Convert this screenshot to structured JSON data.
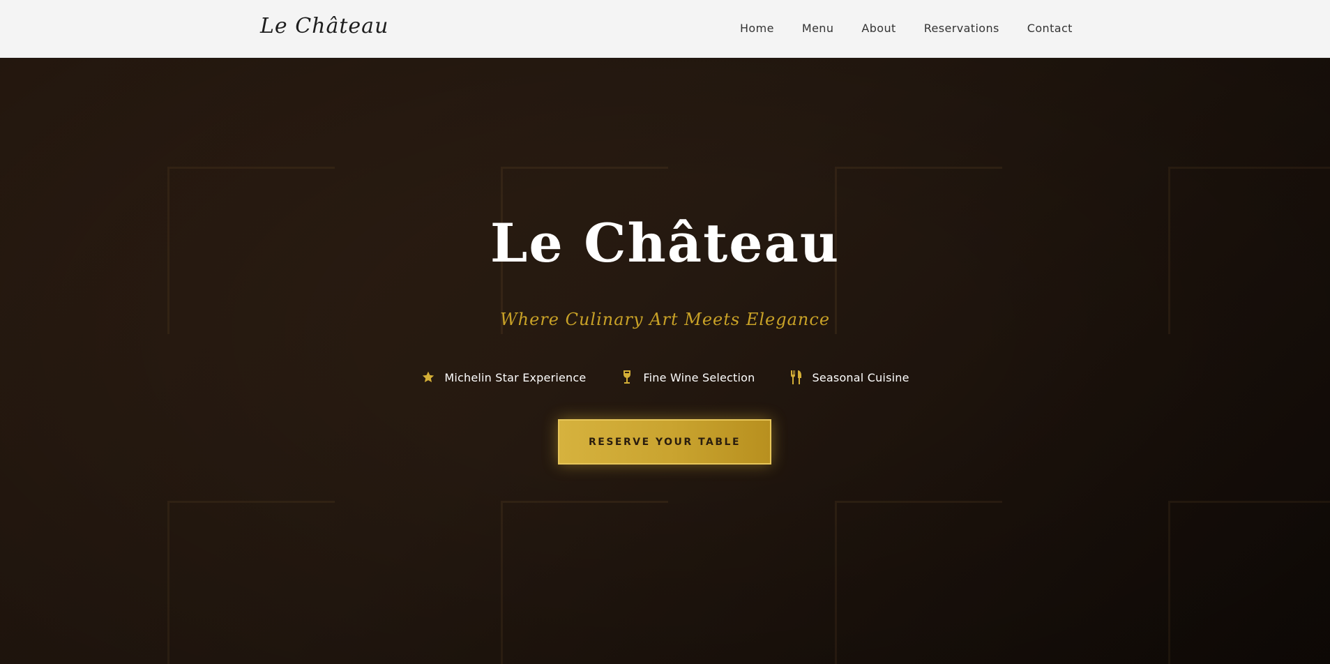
{
  "nav": {
    "brand": "Le Château",
    "links": [
      "Home",
      "Menu",
      "About",
      "Reservations",
      "Contact"
    ]
  },
  "hero": {
    "title": "Le Château",
    "subtitle": "Where Culinary Art Meets Elegance",
    "features": [
      {
        "icon": "star-icon",
        "label": "Michelin Star Experience"
      },
      {
        "icon": "wine-glass-icon",
        "label": "Fine Wine Selection"
      },
      {
        "icon": "utensils-icon",
        "label": "Seasonal Cuisine"
      }
    ],
    "cta_label": "RESERVE YOUR TABLE"
  },
  "colors": {
    "accent_gold": "#d4af37",
    "subtitle_gold": "#c9a227",
    "hero_dark": "#1b120c",
    "nav_background": "#f4f4f4"
  }
}
